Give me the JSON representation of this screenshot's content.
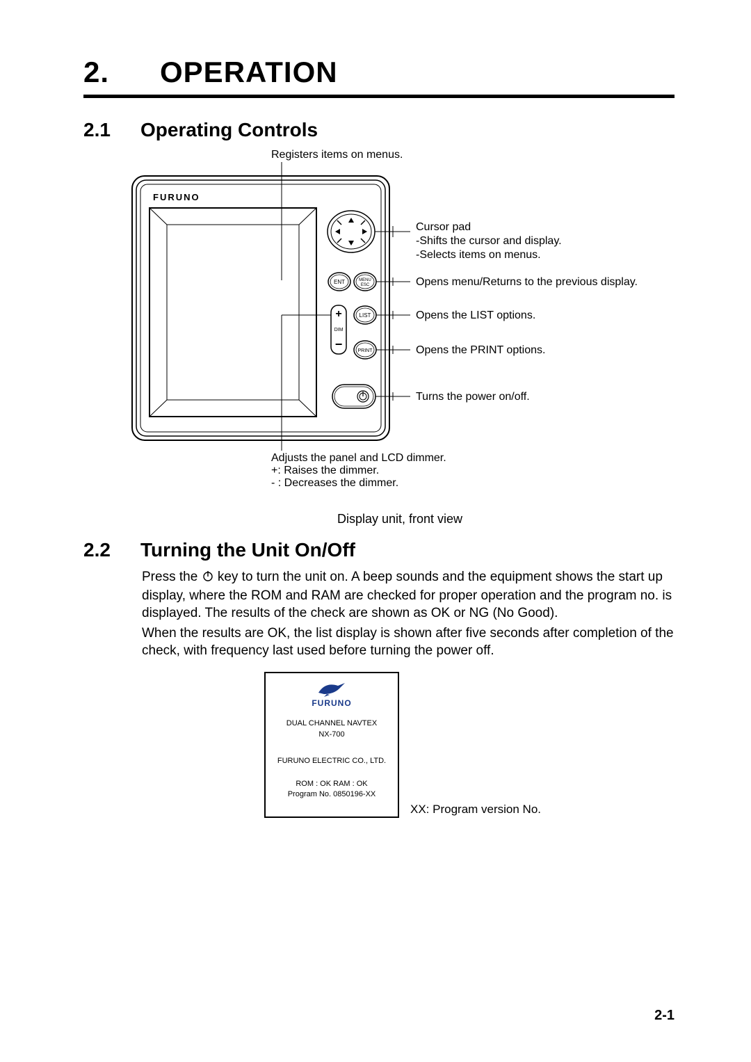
{
  "chapter": {
    "num": "2.",
    "title": "OPERATION"
  },
  "section1": {
    "num": "2.1",
    "title": "Operating Controls"
  },
  "section2": {
    "num": "2.2",
    "title": "Turning the Unit On/Off"
  },
  "diagram": {
    "brand": "FURUNO",
    "ent_label": "ENT",
    "menu_label_top": "MENU",
    "menu_label_bot": "ESC",
    "list_label": "LIST",
    "print_label": "PRINT",
    "dim_label": "DIM",
    "plus": "+",
    "minus": "−",
    "callout_registers": "Registers items on menus.",
    "callout_cursor_l1": "Cursor pad",
    "callout_cursor_l2": "-Shifts the cursor and display.",
    "callout_cursor_l3": "-Selects items on menus.",
    "callout_menu": "Opens menu/Returns to the previous display.",
    "callout_list": "Opens the LIST options.",
    "callout_print": "Opens the PRINT options.",
    "callout_power": "Turns the power on/off.",
    "callout_dim_l1": "Adjusts the panel and LCD dimmer.",
    "callout_dim_l2": "+: Raises the dimmer.",
    "callout_dim_l3": "- : Decreases the dimmer.",
    "caption": "Display unit, front view"
  },
  "body": {
    "p1a": "Press the ",
    "p1b": " key to turn the unit on. A beep sounds and the equipment shows the start up display, where the ROM and RAM are checked for proper operation and the program no. is displayed. The results of the check are shown as OK or NG (No Good).",
    "p2": "When the results are OK, the list display is shown after five seconds after completion of the check, with frequency last used before turning the power off."
  },
  "startup": {
    "brand": "FURUNO",
    "line1": "DUAL CHANNEL NAVTEX",
    "line2": "NX-700",
    "company": "FURUNO ELECTRIC CO., LTD.",
    "check_l1": "ROM : OK    RAM : OK",
    "check_l2": "Program No.  0850196-XX",
    "note": "XX: Program version No."
  },
  "page_num": "2-1"
}
